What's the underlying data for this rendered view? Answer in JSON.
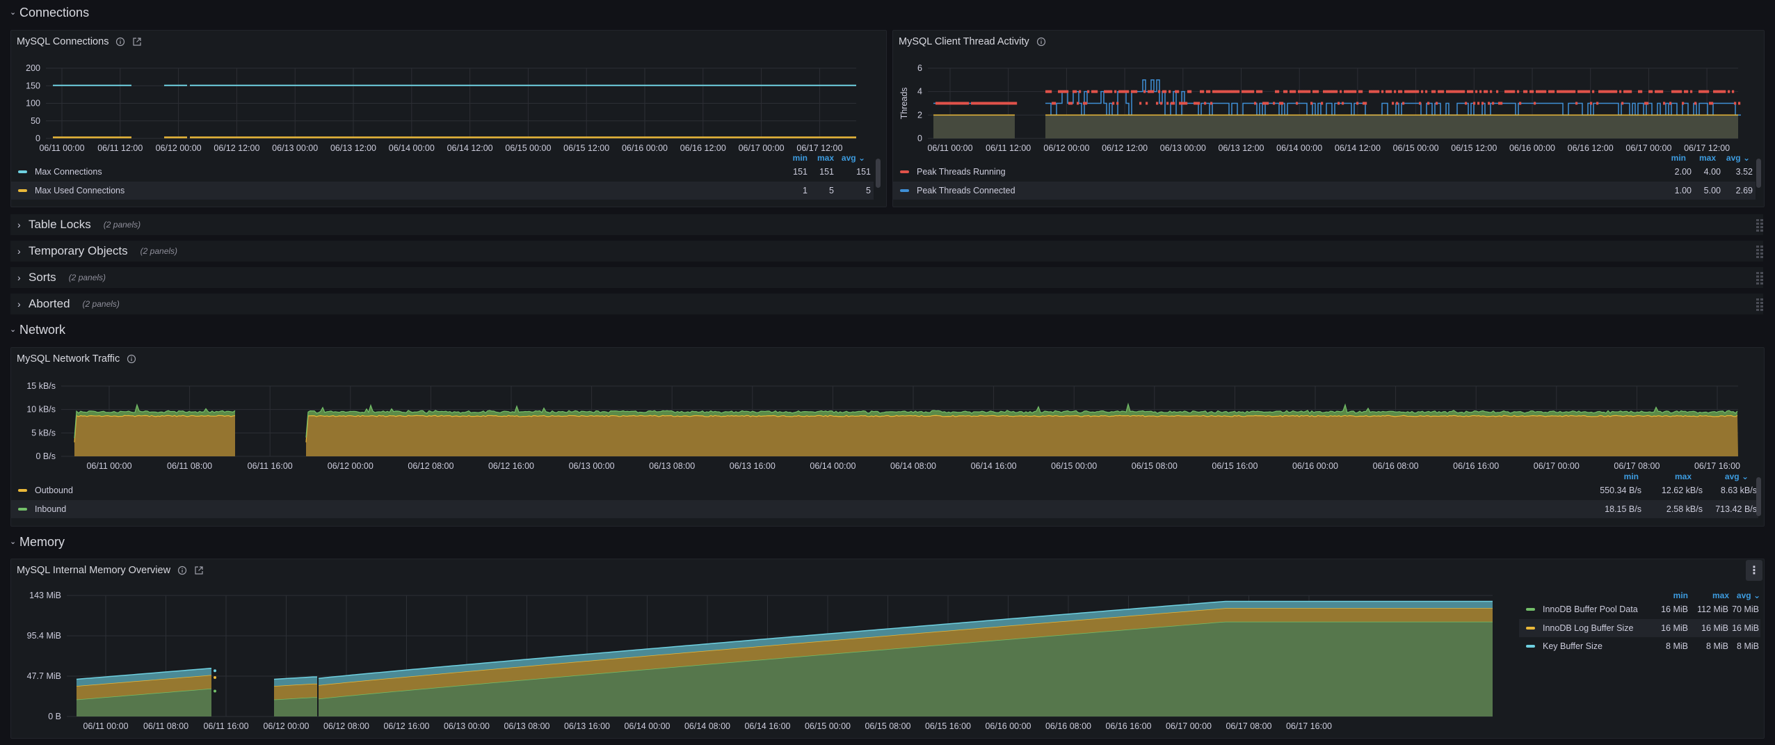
{
  "rows": {
    "connections": {
      "title": "Connections",
      "expanded": true
    },
    "table_locks": {
      "title": "Table Locks",
      "count": "(2 panels)"
    },
    "temporary_objects": {
      "title": "Temporary Objects",
      "count": "(2 panels)"
    },
    "sorts": {
      "title": "Sorts",
      "count": "(2 panels)"
    },
    "aborted": {
      "title": "Aborted",
      "count": "(2 panels)"
    },
    "network": {
      "title": "Network",
      "expanded": true
    },
    "memory": {
      "title": "Memory",
      "expanded": true
    }
  },
  "legend_headers": {
    "min": "min",
    "max": "max",
    "avg": "avg"
  },
  "chart_data": [
    {
      "id": "mysql_connections",
      "type": "line",
      "title": "MySQL Connections",
      "ylabel": "",
      "ylim": [
        0,
        200
      ],
      "yticks": [
        "0",
        "50",
        "100",
        "150",
        "200"
      ],
      "xticks": [
        "06/11 00:00",
        "06/11 12:00",
        "06/12 00:00",
        "06/12 12:00",
        "06/13 00:00",
        "06/13 12:00",
        "06/14 00:00",
        "06/14 12:00",
        "06/15 00:00",
        "06/15 12:00",
        "06/16 00:00",
        "06/16 12:00",
        "06/17 00:00",
        "06/17 12:00"
      ],
      "gap": [
        "06/11 12:40",
        "06/11 22:00"
      ],
      "series": [
        {
          "name": "Max Connections",
          "color": "#6ed0e0",
          "min": "151",
          "max": "151",
          "avg": "151",
          "level": 151
        },
        {
          "name": "Max Used Connections",
          "color": "#eab839",
          "min": "1",
          "max": "5",
          "avg": "5",
          "level": 3
        }
      ]
    },
    {
      "id": "mysql_client_thread_activity",
      "type": "line",
      "title": "MySQL Client Thread Activity",
      "ylabel": "Threads",
      "ylim": [
        0,
        6
      ],
      "yticks": [
        "0",
        "2",
        "4",
        "6"
      ],
      "xticks": [
        "06/11 00:00",
        "06/11 12:00",
        "06/12 00:00",
        "06/12 12:00",
        "06/13 00:00",
        "06/13 12:00",
        "06/14 00:00",
        "06/14 12:00",
        "06/15 00:00",
        "06/15 12:00",
        "06/16 00:00",
        "06/16 12:00",
        "06/17 00:00",
        "06/17 12:00"
      ],
      "series": [
        {
          "name": "Peak Threads Running",
          "color": "#e0524a",
          "min": "2.00",
          "max": "4.00",
          "avg": "3.52"
        },
        {
          "name": "Peak Threads Connected",
          "color": "#3f8fd6",
          "min": "1.00",
          "max": "5.00",
          "avg": "2.69"
        }
      ]
    },
    {
      "id": "mysql_network_traffic",
      "type": "area",
      "title": "MySQL Network Traffic",
      "ylim": [
        0,
        15
      ],
      "yunit": "kB/s",
      "yticks": [
        "0 B/s",
        "5 kB/s",
        "10 kB/s",
        "15 kB/s"
      ],
      "xticks": [
        "06/11 00:00",
        "06/11 08:00",
        "06/11 16:00",
        "06/12 00:00",
        "06/12 08:00",
        "06/12 16:00",
        "06/13 00:00",
        "06/13 08:00",
        "06/13 16:00",
        "06/14 00:00",
        "06/14 08:00",
        "06/14 16:00",
        "06/15 00:00",
        "06/15 08:00",
        "06/15 16:00",
        "06/16 00:00",
        "06/16 08:00",
        "06/16 16:00",
        "06/17 00:00",
        "06/17 08:00",
        "06/17 16:00"
      ],
      "series": [
        {
          "name": "Outbound",
          "color": "#eab839",
          "min": "550.34 B/s",
          "max": "12.62 kB/s",
          "avg": "8.63 kB/s",
          "level": 8.6
        },
        {
          "name": "Inbound",
          "color": "#73bf69",
          "min": "18.15 B/s",
          "max": "2.58 kB/s",
          "avg": "713.42 B/s",
          "level": 0.7
        }
      ]
    },
    {
      "id": "mysql_internal_memory_overview",
      "type": "area",
      "title": "MySQL Internal Memory Overview",
      "ylim": [
        0,
        143
      ],
      "yunit": "MiB",
      "yticks": [
        "0 B",
        "47.7 MiB",
        "95.4 MiB",
        "143 MiB"
      ],
      "xticks": [
        "06/11 00:00",
        "06/11 08:00",
        "06/11 16:00",
        "06/12 00:00",
        "06/12 08:00",
        "06/12 16:00",
        "06/13 00:00",
        "06/13 08:00",
        "06/13 16:00",
        "06/14 00:00",
        "06/14 08:00",
        "06/14 16:00",
        "06/15 00:00",
        "06/15 08:00",
        "06/15 16:00",
        "06/16 00:00",
        "06/16 08:00",
        "06/16 16:00",
        "06/17 00:00",
        "06/17 08:00",
        "06/17 16:00"
      ],
      "stacked": true,
      "series": [
        {
          "name": "InnoDB Buffer Pool Data",
          "color": "#73bf69",
          "min": "16 MiB",
          "max": "112 MiB",
          "avg": "70 MiB"
        },
        {
          "name": "InnoDB Log Buffer Size",
          "color": "#eab839",
          "min": "16 MiB",
          "max": "16 MiB",
          "avg": "16 MiB"
        },
        {
          "name": "Key Buffer Size",
          "color": "#6ed0e0",
          "min": "8 MiB",
          "max": "8 MiB",
          "avg": "8 MiB"
        }
      ]
    }
  ]
}
